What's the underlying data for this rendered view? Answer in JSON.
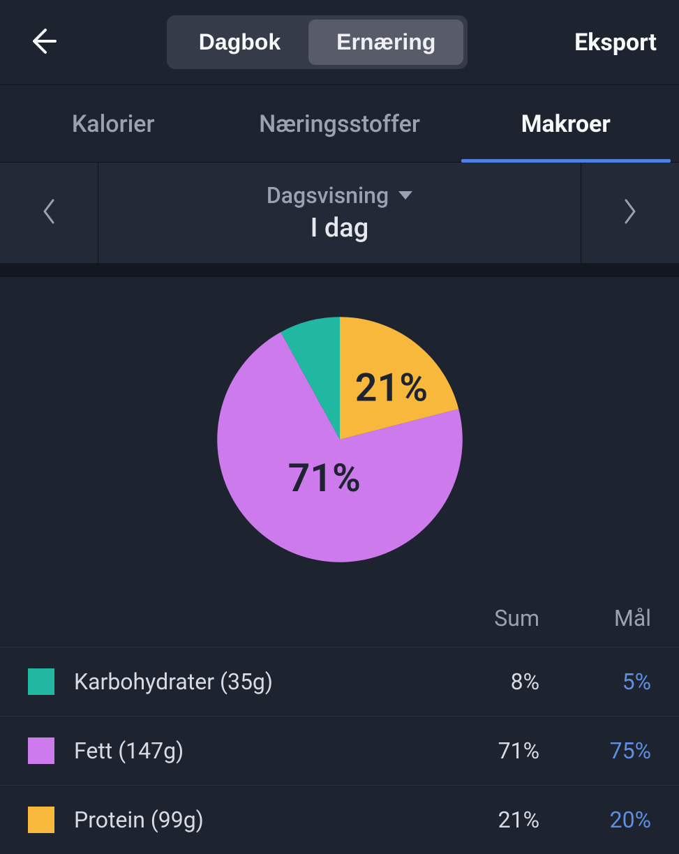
{
  "header": {
    "segmented": {
      "left": "Dagbok",
      "right": "Ernæring",
      "active": "right"
    },
    "export_label": "Eksport"
  },
  "tabs": {
    "items": [
      "Kalorier",
      "Næringsstoffer",
      "Makroer"
    ],
    "active_index": 2
  },
  "date": {
    "view_mode": "Dagsvisning",
    "current": "I dag"
  },
  "chart_data": {
    "type": "pie",
    "title": "",
    "series": [
      {
        "name": "Karbohydrater",
        "value": 8,
        "color": "#21b8a2"
      },
      {
        "name": "Fett",
        "value": 71,
        "color": "#cd7aec"
      },
      {
        "name": "Protein",
        "value": 21,
        "color": "#f8b83b"
      }
    ],
    "labels_shown": [
      "71%",
      "21%"
    ]
  },
  "table": {
    "headers": {
      "sum": "Sum",
      "goal": "Mål"
    },
    "rows": [
      {
        "color": "#21b8a2",
        "label": "Karbohydrater (35g)",
        "sum": "8%",
        "goal": "5%"
      },
      {
        "color": "#cd7aec",
        "label": "Fett (147g)",
        "sum": "71%",
        "goal": "75%"
      },
      {
        "color": "#f8b83b",
        "label": "Protein (99g)",
        "sum": "21%",
        "goal": "20%"
      }
    ]
  }
}
